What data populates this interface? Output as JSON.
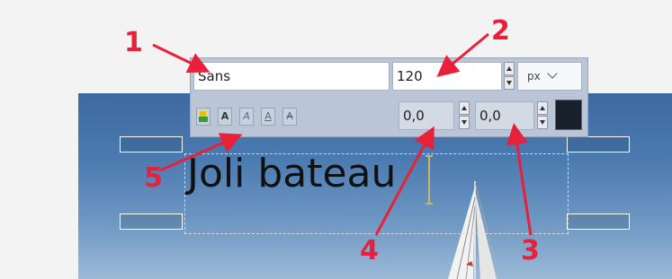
{
  "toolbar": {
    "font_name": "Sans",
    "font_size": "120",
    "unit": "px",
    "letter_spacing": "0,0",
    "line_spacing": "0,0",
    "text_color": "#17202b",
    "style_buttons": [
      {
        "icon": "clear-style-icon",
        "glyph": ""
      },
      {
        "icon": "bold-icon",
        "glyph": "A"
      },
      {
        "icon": "italic-icon",
        "glyph": "A"
      },
      {
        "icon": "underline-icon",
        "glyph": "A"
      },
      {
        "icon": "strikethrough-icon",
        "glyph": "A"
      }
    ]
  },
  "canvas": {
    "text": "Joli bateau"
  },
  "annotations": [
    {
      "label": "1"
    },
    {
      "label": "2"
    },
    {
      "label": "3"
    },
    {
      "label": "4"
    },
    {
      "label": "5"
    }
  ],
  "colors": {
    "annotation": "#e8203a",
    "toolbar_bg": "#bac6d6",
    "sky_top": "#3c6aa0"
  }
}
